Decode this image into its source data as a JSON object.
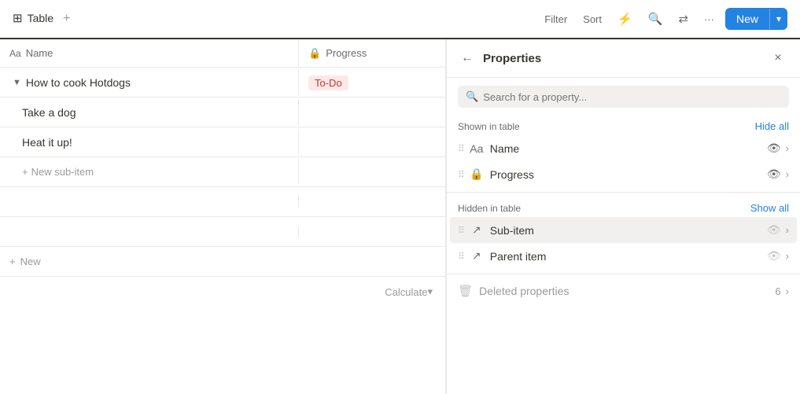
{
  "topbar": {
    "tab_label": "Table",
    "add_view_icon": "+",
    "filter_label": "Filter",
    "sort_label": "Sort",
    "lightning_icon": "⚡",
    "search_icon": "🔍",
    "shuffle_icon": "↕",
    "more_icon": "···",
    "new_label": "New",
    "new_arrow": "▾"
  },
  "table": {
    "col_name": "Name",
    "col_name_icon": "Aa",
    "col_progress": "Progress",
    "col_progress_icon": "🔒",
    "rows": [
      {
        "name": "How to cook Hotdogs",
        "progress": "To-Do",
        "indent": 0,
        "expanded": true,
        "is_header": true
      },
      {
        "name": "Take a dog",
        "progress": "",
        "indent": 1
      },
      {
        "name": "Heat it up!",
        "progress": "",
        "indent": 1
      }
    ],
    "new_sub_item_label": "New sub-item",
    "new_label": "New",
    "calculate_label": "Calculate",
    "calculate_icon": "▾"
  },
  "panel": {
    "title": "Properties",
    "back_icon": "←",
    "close_icon": "×",
    "search_placeholder": "Search for a property...",
    "shown_section": "Shown in table",
    "hide_all_label": "Hide all",
    "shown_properties": [
      {
        "icon": "Aa",
        "name": "Name"
      },
      {
        "icon": "🔒",
        "name": "Progress"
      }
    ],
    "hidden_section": "Hidden in table",
    "show_all_label": "Show all",
    "hidden_properties": [
      {
        "icon": "↗",
        "name": "Sub-item"
      },
      {
        "icon": "↗",
        "name": "Parent item"
      }
    ],
    "deleted_label": "Deleted properties",
    "deleted_count": "6"
  }
}
